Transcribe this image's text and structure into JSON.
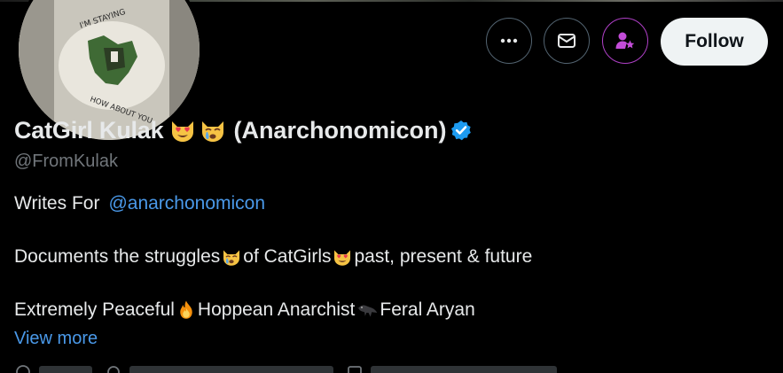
{
  "profile": {
    "display_name": "CatGirl Kulak",
    "display_name_suffix": "(Anarchonomicon)",
    "handle": "@FromKulak",
    "verified": true,
    "name_emojis": [
      "heart-eyes-cat-emoji",
      "crying-cat-emoji"
    ]
  },
  "actions": {
    "more_icon": "more-dots-icon",
    "message_icon": "envelope-icon",
    "subscribe_icon": "person-star-icon",
    "follow_label": "Follow"
  },
  "bio": {
    "line1_prefix": "Writes For",
    "line1_mention": "@anarchonomicon",
    "line2_part1": "Documents the struggles",
    "line2_part2": " of CatGirls",
    "line2_part3": " past, present & future",
    "line3_part1": "Extremely Peaceful",
    "line3_part2": " Hoppean Anarchist",
    "line3_part3": "Feral Aryan"
  },
  "view_more_label": "View more",
  "avatar": {
    "shirt_text_top": "I'M STAYING",
    "shirt_text_bottom": "HOW ABOUT YOU"
  },
  "colors": {
    "background": "#000000",
    "text_primary": "#e7e9ea",
    "text_secondary": "#71767b",
    "link": "#4a99e9",
    "verified": "#1d9bf0",
    "follow_bg": "#eff3f4",
    "subscribe_accent": "#b040c8"
  }
}
